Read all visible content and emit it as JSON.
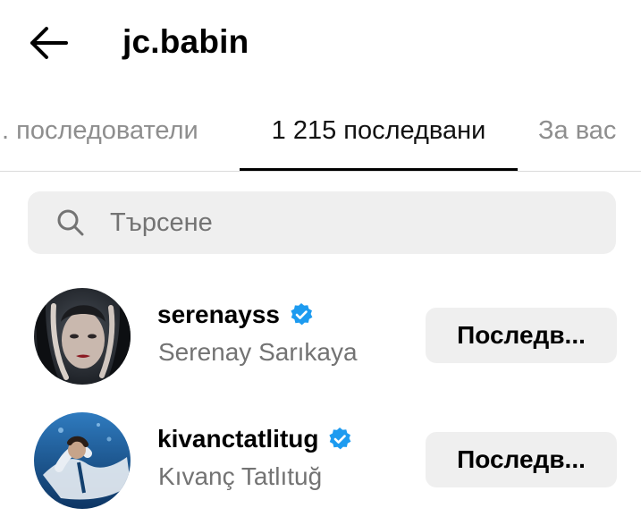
{
  "header": {
    "back_icon": "arrow-left-icon",
    "title": "jc.babin"
  },
  "tabs": [
    {
      "label": ". последователи",
      "active": false
    },
    {
      "label": "1 215 последвани",
      "active": true
    },
    {
      "label": "За вас",
      "active": false
    }
  ],
  "search": {
    "icon": "search-icon",
    "placeholder": "Търсене",
    "value": ""
  },
  "users": [
    {
      "username": "serenayss",
      "verified": true,
      "full_name": "Serenay Sarıkaya",
      "button_label": "Последв..."
    },
    {
      "username": "kivanctatlitug",
      "verified": true,
      "full_name": "Kıvanç Tatlıtuğ",
      "button_label": "Последв..."
    }
  ],
  "colors": {
    "verified_badge": "#1d9bf0",
    "muted_text": "#737373",
    "button_bg": "#efefef"
  }
}
